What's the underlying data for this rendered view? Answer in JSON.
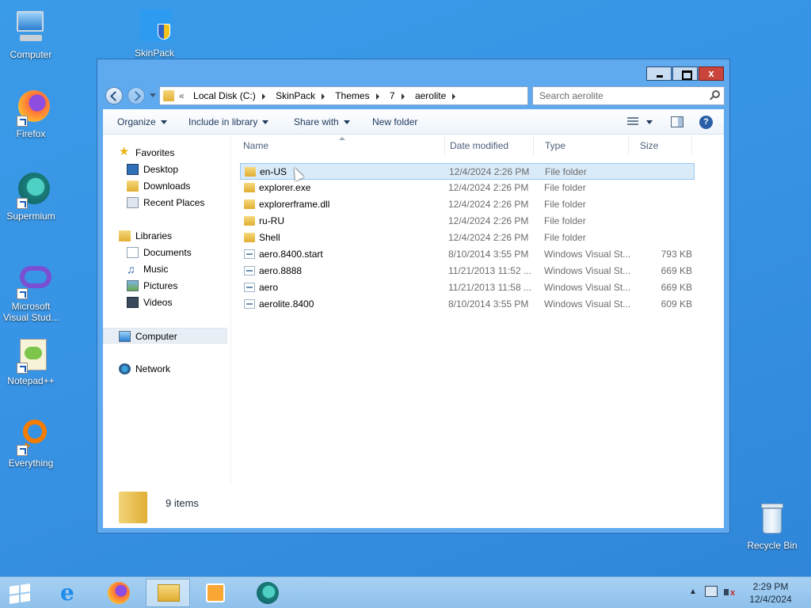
{
  "desktop": {
    "icons": [
      {
        "label": "Computer"
      },
      {
        "label": "SkinPack"
      },
      {
        "label": "Firefox"
      },
      {
        "label": "Supermium"
      },
      {
        "label": "Microsoft Visual Stud..."
      },
      {
        "label": "Notepad++"
      },
      {
        "label": "Everything"
      },
      {
        "label": "Recycle Bin"
      }
    ]
  },
  "window": {
    "address": {
      "overflow": "«",
      "crumbs": [
        "Local Disk (C:)",
        "SkinPack",
        "Themes",
        "7",
        "aerolite"
      ]
    },
    "search": {
      "placeholder": "Search aerolite"
    },
    "commands": {
      "organize": "Organize",
      "include_in_library": "Include in library",
      "share_with": "Share with",
      "new_folder": "New folder",
      "help": "?"
    },
    "navpane": {
      "favorites": "Favorites",
      "desktop": "Desktop",
      "downloads": "Downloads",
      "recent_places": "Recent Places",
      "libraries": "Libraries",
      "documents": "Documents",
      "music": "Music",
      "pictures": "Pictures",
      "videos": "Videos",
      "computer": "Computer",
      "network": "Network"
    },
    "columns": {
      "name": "Name",
      "date": "Date modified",
      "type": "Type",
      "size": "Size"
    },
    "files": [
      {
        "name": "en-US",
        "date": "12/4/2024 2:26 PM",
        "type": "File folder",
        "size": "",
        "kind": "folder",
        "selected": true
      },
      {
        "name": "explorer.exe",
        "date": "12/4/2024 2:26 PM",
        "type": "File folder",
        "size": "",
        "kind": "folder"
      },
      {
        "name": "explorerframe.dll",
        "date": "12/4/2024 2:26 PM",
        "type": "File folder",
        "size": "",
        "kind": "folder"
      },
      {
        "name": "ru-RU",
        "date": "12/4/2024 2:26 PM",
        "type": "File folder",
        "size": "",
        "kind": "folder"
      },
      {
        "name": "Shell",
        "date": "12/4/2024 2:26 PM",
        "type": "File folder",
        "size": "",
        "kind": "folder"
      },
      {
        "name": "aero.8400.start",
        "date": "8/10/2014 3:55 PM",
        "type": "Windows Visual St...",
        "size": "793 KB",
        "kind": "file"
      },
      {
        "name": "aero.8888",
        "date": "11/21/2013 11:52 ...",
        "type": "Windows Visual St...",
        "size": "669 KB",
        "kind": "file"
      },
      {
        "name": "aero",
        "date": "11/21/2013 11:58 ...",
        "type": "Windows Visual St...",
        "size": "669 KB",
        "kind": "file"
      },
      {
        "name": "aerolite.8400",
        "date": "8/10/2014 3:55 PM",
        "type": "Windows Visual St...",
        "size": "609 KB",
        "kind": "file"
      }
    ],
    "details": {
      "item_count": "9 items"
    },
    "title_buttons": {
      "close": "x"
    }
  },
  "taskbar": {
    "clock_time": "2:29 PM",
    "clock_date": "12/4/2024",
    "apps": [
      "start-icon",
      "internet-explorer-icon",
      "firefox-icon",
      "file-explorer-icon",
      "media-player-icon",
      "supermium-icon"
    ]
  }
}
